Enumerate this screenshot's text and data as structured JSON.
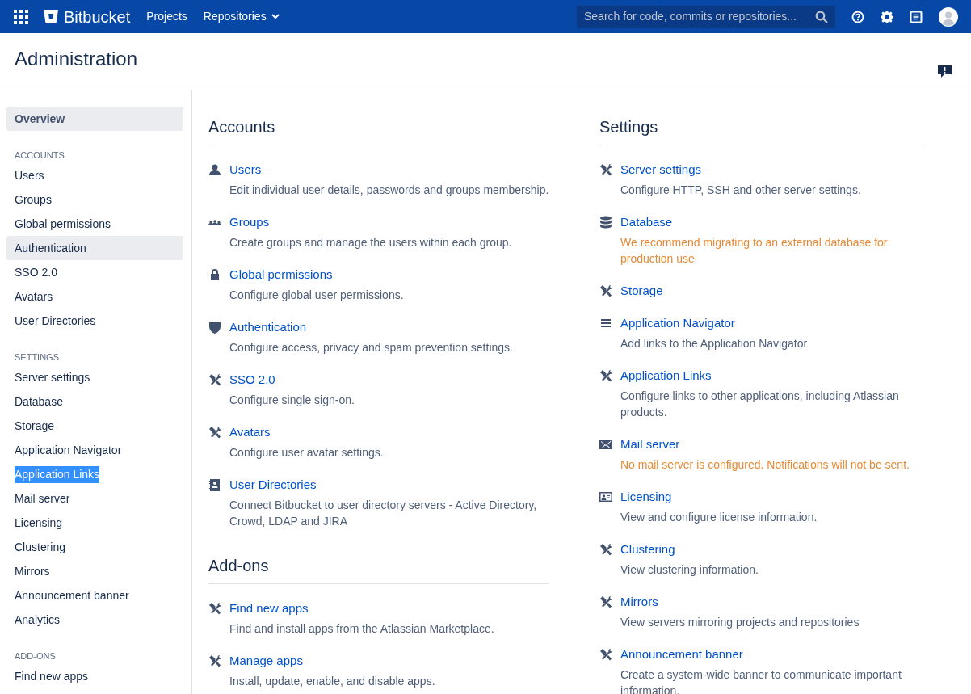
{
  "topbar": {
    "product": "Bitbucket",
    "nav": [
      {
        "label": "Projects",
        "dropdown": false
      },
      {
        "label": "Repositories",
        "dropdown": true
      }
    ],
    "search": {
      "placeholder": "Search for code, commits or repositories..."
    }
  },
  "page_title": "Administration",
  "sidebar": {
    "overview": {
      "label": "Overview",
      "selected": true
    },
    "groups": [
      {
        "heading": "ACCOUNTS",
        "items": [
          {
            "label": "Users",
            "selected": false,
            "highlighted": false
          },
          {
            "label": "Groups",
            "selected": false,
            "highlighted": false
          },
          {
            "label": "Global permissions",
            "selected": false,
            "highlighted": false
          },
          {
            "label": "Authentication",
            "selected": true,
            "highlighted": false
          },
          {
            "label": "SSO 2.0",
            "selected": false,
            "highlighted": false
          },
          {
            "label": "Avatars",
            "selected": false,
            "highlighted": false
          },
          {
            "label": "User Directories",
            "selected": false,
            "highlighted": false
          }
        ]
      },
      {
        "heading": "SETTINGS",
        "items": [
          {
            "label": "Server settings",
            "selected": false,
            "highlighted": false
          },
          {
            "label": "Database",
            "selected": false,
            "highlighted": false
          },
          {
            "label": "Storage",
            "selected": false,
            "highlighted": false
          },
          {
            "label": "Application Navigator",
            "selected": false,
            "highlighted": false
          },
          {
            "label": "Application Links",
            "selected": false,
            "highlighted": true
          },
          {
            "label": "Mail server",
            "selected": false,
            "highlighted": false
          },
          {
            "label": "Licensing",
            "selected": false,
            "highlighted": false
          },
          {
            "label": "Clustering",
            "selected": false,
            "highlighted": false
          },
          {
            "label": "Mirrors",
            "selected": false,
            "highlighted": false
          },
          {
            "label": "Announcement banner",
            "selected": false,
            "highlighted": false
          },
          {
            "label": "Analytics",
            "selected": false,
            "highlighted": false
          }
        ]
      },
      {
        "heading": "ADD-ONS",
        "items": [
          {
            "label": "Find new apps",
            "selected": false,
            "highlighted": false
          }
        ]
      }
    ]
  },
  "columns": [
    [
      {
        "title": "Accounts",
        "entries": [
          {
            "kind": "user",
            "title": "Users",
            "description": "Edit individual user details, passwords and groups membership.",
            "warning": false
          },
          {
            "kind": "groups",
            "title": "Groups",
            "description": "Create groups and manage the users within each group.",
            "warning": false
          },
          {
            "kind": "lock",
            "title": "Global permissions",
            "description": "Configure global user permissions.",
            "warning": false
          },
          {
            "kind": "shield",
            "title": "Authentication",
            "description": "Configure access, privacy and spam prevention settings.",
            "warning": false
          },
          {
            "kind": "tools",
            "title": "SSO 2.0",
            "description": "Configure single sign-on.",
            "warning": false
          },
          {
            "kind": "tools",
            "title": "Avatars",
            "description": "Configure user avatar settings.",
            "warning": false
          },
          {
            "kind": "book",
            "title": "User Directories",
            "description": "Connect Bitbucket to user directory servers - Active Directory, Crowd, LDAP and JIRA",
            "warning": false
          }
        ]
      },
      {
        "title": "Add-ons",
        "entries": [
          {
            "kind": "tools",
            "title": "Find new apps",
            "description": "Find and install apps from the Atlassian Marketplace.",
            "warning": false
          },
          {
            "kind": "tools",
            "title": "Manage apps",
            "description": "Install, update, enable, and disable apps.",
            "warning": false
          }
        ]
      }
    ],
    [
      {
        "title": "Settings",
        "entries": [
          {
            "kind": "tools",
            "title": "Server settings",
            "description": "Configure HTTP, SSH and other server settings.",
            "warning": false
          },
          {
            "kind": "database",
            "title": "Database",
            "description": "We recommend migrating to an external database for production use",
            "warning": true
          },
          {
            "kind": "tools",
            "title": "Storage"
          },
          {
            "kind": "lines",
            "title": "Application Navigator",
            "description": "Add links to the Application Navigator",
            "warning": false
          },
          {
            "kind": "tools",
            "title": "Application Links",
            "description": "Configure links to other applications, including Atlassian products.",
            "warning": false
          },
          {
            "kind": "mail",
            "title": "Mail server",
            "description": "No mail server is configured. Notifications will not be sent.",
            "warning": true
          },
          {
            "kind": "card",
            "title": "Licensing",
            "description": "View and configure license information.",
            "warning": false
          },
          {
            "kind": "tools",
            "title": "Clustering",
            "description": "View clustering information.",
            "warning": false
          },
          {
            "kind": "tools",
            "title": "Mirrors",
            "description": "View servers mirroring projects and repositories",
            "warning": false
          },
          {
            "kind": "tools",
            "title": "Announcement banner",
            "description": "Create a system-wide banner to communicate important information.",
            "warning": false
          }
        ]
      }
    ]
  ]
}
